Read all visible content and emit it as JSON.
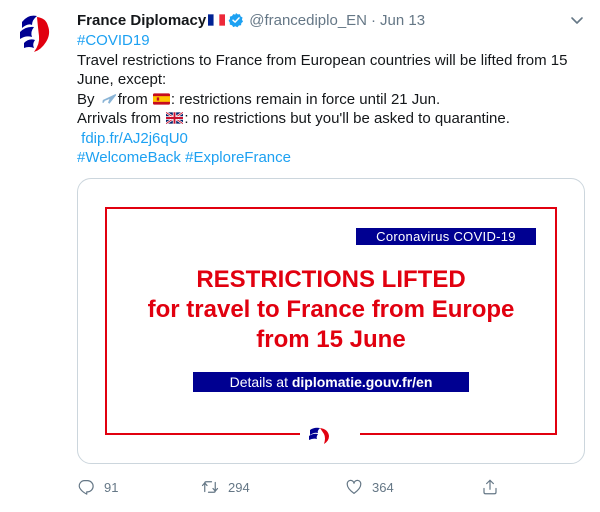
{
  "tweet": {
    "display_name": "France Diplomacy",
    "handle": "@francediplo_EN",
    "separator": "·",
    "time": "Jun 13",
    "lines": {
      "hashtag_covid": "#COVID19",
      "line1": "Travel restrictions to France from European countries will be lifted from 15",
      "line2": "June, except:",
      "line3_a": "By ",
      "line3_b": "from ",
      "line3_c": ": restrictions remain in force until 21 Jun.",
      "line4_a": "Arrivals from ",
      "line4_b": ": no restrictions but you'll be asked to quarantine.",
      "short_link": "fdip.fr/AJ2j6qU0",
      "hashtag_welcome": "#WelcomeBack",
      "hashtag_explore": "#ExploreFrance"
    },
    "card": {
      "badge": "Coronavirus COVID-19",
      "headline_1": "RESTRICTIONS LIFTED",
      "headline_2": "for travel to France from Europe",
      "headline_3": "from 15 June",
      "details_prefix": "Details at ",
      "details_link": "diplomatie.gouv.fr/en"
    },
    "actions": {
      "replies": "91",
      "retweets": "294",
      "likes": "364"
    },
    "colors": {
      "link": "#1da1f2",
      "red": "#e1000f",
      "navy": "#000091",
      "muted": "#657786"
    }
  }
}
